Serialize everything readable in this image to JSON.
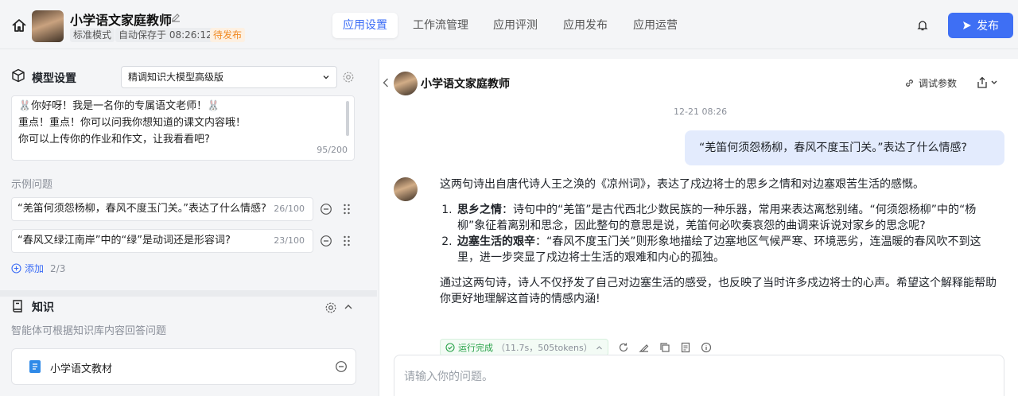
{
  "header": {
    "app_title": "小学语文家庭教师",
    "mode_tag": "标准模式",
    "autosave_tag": "自动保存于 08:26:12",
    "status_tag": "待发布",
    "publish_label": "发布"
  },
  "nav": {
    "tabs": [
      {
        "label": "应用设置",
        "active": true
      },
      {
        "label": "工作流管理",
        "active": false
      },
      {
        "label": "应用评测",
        "active": false
      },
      {
        "label": "应用发布",
        "active": false
      },
      {
        "label": "应用运营",
        "active": false
      }
    ]
  },
  "settings": {
    "model_title": "模型设置",
    "model_selected": "精调知识大模型高级版",
    "prompt_lines": [
      "🐰你好呀！我是一名你的专属语文老师！🐰",
      "重点！重点！你可以问我你想知道的课文内容哦！",
      "你可以上传你的作业和作文，让我看看吧?"
    ],
    "prompt_count": "95/200",
    "examples_label": "示例问题",
    "examples": [
      {
        "text": "“羌笛何须怨杨柳，春风不度玉门关。”表达了什么情感?",
        "count": "26/100"
      },
      {
        "text": "“春风又绿江南岸”中的“绿”是动词还是形容词?",
        "count": "23/100"
      }
    ],
    "add_label": "添加",
    "add_count": "2/3",
    "knowledge_title": "知识",
    "knowledge_desc": "智能体可根据知识库内容回答问题",
    "knowledge_item": "小学语文教材"
  },
  "chat": {
    "bot_name": "小学语文家庭教师",
    "debug_label": "调试参数",
    "timestamp": "12-21 08:26",
    "user_message": "“羌笛何须怨杨柳，春风不度玉门关。”表达了什么情感?",
    "reply_intro": "这两句诗出自唐代诗人王之涣的《凉州词》，表达了戍边将士的思乡之情和对边塞艰苦生活的感慨。",
    "reply_points": [
      {
        "title": "思乡之情",
        "body": "：诗句中的“羌笛”是古代西北少数民族的一种乐器，常用来表达离愁别绪。“何须怨杨柳”中的“杨柳”象征着离别和思念，因此整句的意思是说，羌笛何必吹奏哀怨的曲调来诉说对家乡的思念呢?"
      },
      {
        "title": "边塞生活的艰辛",
        "body": "：“春风不度玉门关”则形象地描绘了边塞地区气候严寒、环境恶劣，连温暖的春风吹不到这里，进一步突显了戍边将士生活的艰难和内心的孤独。"
      }
    ],
    "reply_outro": "通过这两句诗，诗人不仅抒发了自己对边塞生活的感受，也反映了当时许多戍边将士的心声。希望这个解释能帮助你更好地理解这首诗的情感内涵!",
    "status_label": "运行完成",
    "status_meta": "（11.7s，505tokens）",
    "input_placeholder": "请输入你的问题。"
  },
  "colors": {
    "accent": "#3e6ff4",
    "user_bubble": "#e3ebfd",
    "success": "#27a148",
    "pending": "#f08a24"
  },
  "icons": [
    "home-icon",
    "edit-icon",
    "bell-icon",
    "send-icon",
    "cube-icon",
    "chevron-down-icon",
    "gear-icon",
    "minus-circle-icon",
    "drag-handle-icon",
    "plus-circle-icon",
    "book-icon",
    "chevron-up-icon",
    "doc-icon",
    "back-icon",
    "link-icon",
    "share-icon",
    "check-circle-icon",
    "refresh-icon",
    "brush-icon",
    "copy-icon",
    "note-icon",
    "info-icon"
  ]
}
